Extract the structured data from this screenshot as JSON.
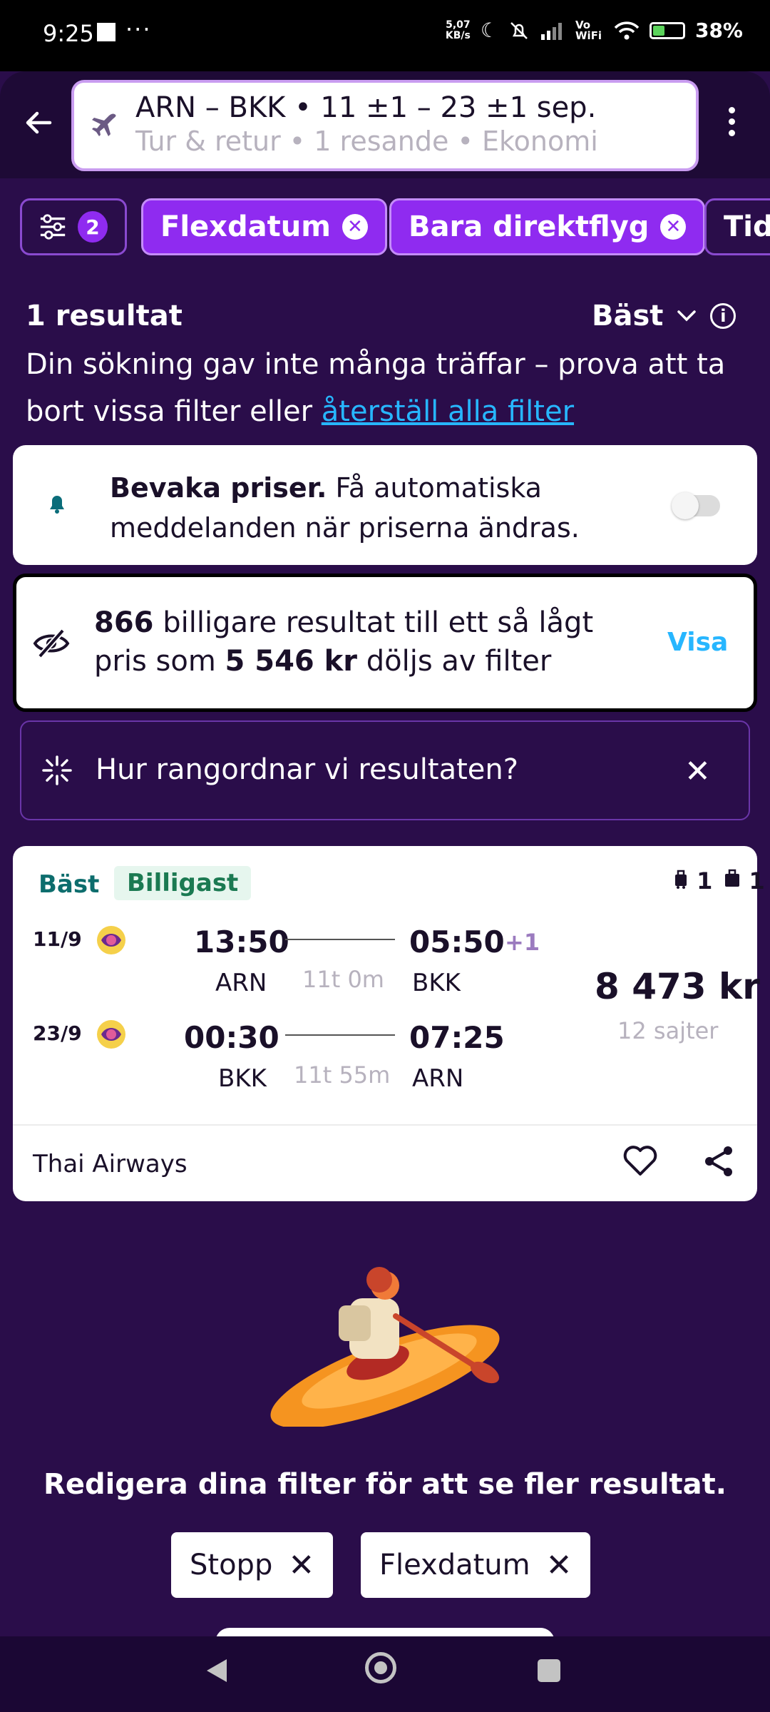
{
  "status_bar": {
    "time": "9:25",
    "more": "···",
    "speed_value": "5,07",
    "speed_unit": "KB/s",
    "vowifi": "Vo WiFi",
    "battery": "38%"
  },
  "header": {
    "route": "ARN – BKK • 11 ±1 – 23 ±1 sep.",
    "details": "Tur & retur • 1 resande • Ekonomi"
  },
  "filters": {
    "settings_count": "2",
    "chips": [
      {
        "label": "Flexdatum"
      },
      {
        "label": "Bara direktflyg"
      },
      {
        "label": "Tid"
      }
    ]
  },
  "results": {
    "count": "1 resultat",
    "sort": "Bäst",
    "message_prefix": "Din sökning gav inte många träffar – prova att ta bort vissa filter eller",
    "reset_link": "återställ alla filter"
  },
  "price_alert": {
    "title": "Bevaka priser.",
    "text": "Få automatiska meddelanden när priserna ändras."
  },
  "hidden_results": {
    "count": "866",
    "text_mid": "billigare resultat till ett så lågt pris som",
    "price": "5 546 kr",
    "text_end": "döljs av filter",
    "action": "Visa"
  },
  "ranking": {
    "question": "Hur rangordnar vi resultaten?"
  },
  "flight": {
    "badges": [
      "Bäst",
      "Billigast"
    ],
    "carry_on": "1",
    "checked": "1",
    "legs": [
      {
        "date": "11/9",
        "dep_time": "13:50",
        "dep_airport": "ARN",
        "duration": "11t 0m",
        "arr_time": "05:50",
        "plus_day": "+1",
        "arr_airport": "BKK"
      },
      {
        "date": "23/9",
        "dep_time": "00:30",
        "dep_airport": "BKK",
        "duration": "11t 55m",
        "arr_time": "07:25",
        "plus_day": "",
        "arr_airport": "ARN"
      }
    ],
    "price": "8 473 kr",
    "sites": "12 sajter",
    "airline": "Thai Airways"
  },
  "empty_state": {
    "message": "Redigera dina filter för att se fler resultat.",
    "pills": [
      "Stopp",
      "Flexdatum"
    ]
  },
  "colors": {
    "background": "#2a0d4a",
    "accent": "#8f2bf0",
    "link": "#27b6ff"
  }
}
